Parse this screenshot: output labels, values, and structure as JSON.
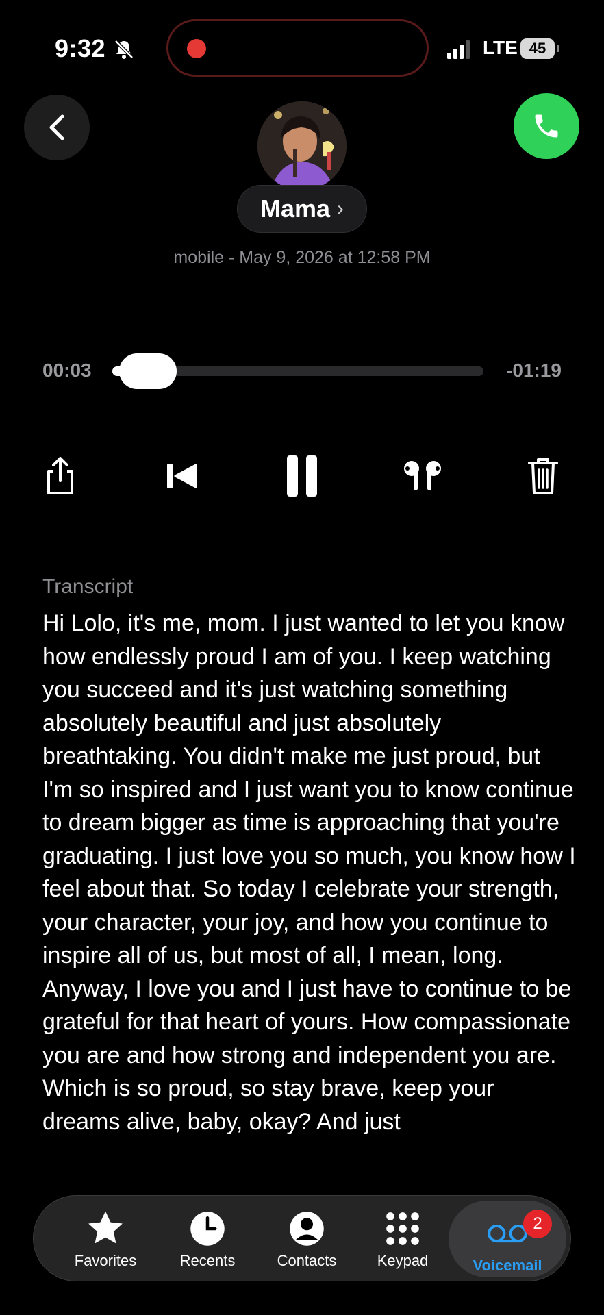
{
  "status_bar": {
    "time": "9:32",
    "network": "LTE",
    "battery": "45"
  },
  "contact": {
    "name": "Mama",
    "subtitle": "mobile - May 9, 2026 at 12:58 PM"
  },
  "player": {
    "elapsed": "00:03",
    "remaining": "-01:19",
    "progress_fraction": 0.037
  },
  "transcript": {
    "label": "Transcript",
    "text": "Hi Lolo, it's me, mom.  I just wanted to let you know how endlessly proud I am of you.  I keep watching you succeed and it's just watching something absolutely beautiful and just absolutely breathtaking.  You didn't make me just proud, but I'm so inspired and I just want you to know continue to dream bigger as time is approaching that you're graduating.  I just love you so much, you know how I feel about that.  So today I celebrate your strength, your character, your joy, and how you continue to inspire all of us, but most of all, I mean, long.  Anyway, I love you and I just have to continue to be grateful for that heart of yours.  How compassionate you are and how strong and independent you are.  Which is so proud, so stay brave, keep your dreams alive, baby, okay?  And just"
  },
  "tabs": [
    {
      "label": "Favorites",
      "icon": "star-icon"
    },
    {
      "label": "Recents",
      "icon": "clock-icon"
    },
    {
      "label": "Contacts",
      "icon": "person-icon"
    },
    {
      "label": "Keypad",
      "icon": "keypad-icon"
    },
    {
      "label": "Voicemail",
      "icon": "voicemail-icon",
      "badge": "2",
      "active": true
    }
  ],
  "colors": {
    "accent": "#2a9df4",
    "call_green": "#30d158",
    "badge_red": "#e5252a",
    "record_red": "#e53935"
  }
}
